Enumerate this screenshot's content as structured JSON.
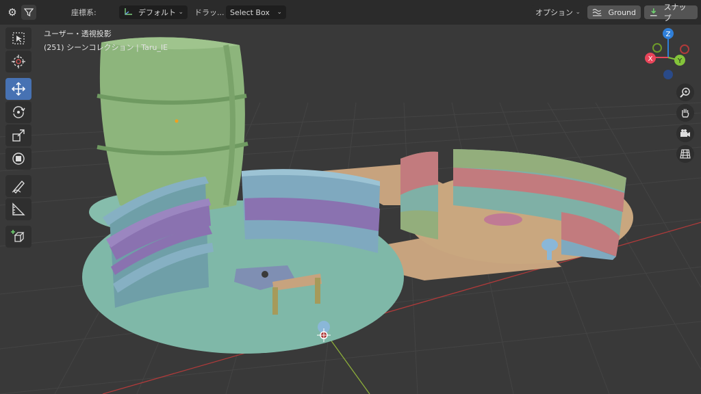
{
  "header": {
    "coord_label": "座標系:",
    "coord_value": "デフォルト",
    "drag_label": "ドラッ...",
    "select_value": "Select Box",
    "options_label": "オプション",
    "ground_label": "Ground",
    "snap_label": "スナップ"
  },
  "viewport": {
    "view_mode": "ユーザー・透視投影",
    "collection_info": "(251) シーンコレクション | Taru_IE"
  },
  "gizmo": {
    "x_label": "X",
    "y_label": "Y",
    "z_label": "Z",
    "x_color": "#e8455a",
    "y_color": "#84c43a",
    "z_color": "#2f7fd9"
  },
  "colors": {
    "accent": "#4772b3",
    "barrel": "#8db57c",
    "floor": "#7fb8a8",
    "shelf_blue": "#7fa9bf",
    "shelf_purple": "#8a72b0",
    "path": "#c7a37e",
    "shelf_red": "#c27b7e",
    "shelf_green": "#93ae7c"
  },
  "tools": [
    {
      "icon": "select-box-icon"
    },
    {
      "icon": "cursor-icon"
    },
    {
      "icon": "move-icon"
    },
    {
      "icon": "rotate-icon"
    },
    {
      "icon": "scale-icon"
    },
    {
      "icon": "transform-icon"
    },
    {
      "icon": "annotate-icon"
    },
    {
      "icon": "measure-icon"
    },
    {
      "icon": "add-cube-icon"
    }
  ]
}
